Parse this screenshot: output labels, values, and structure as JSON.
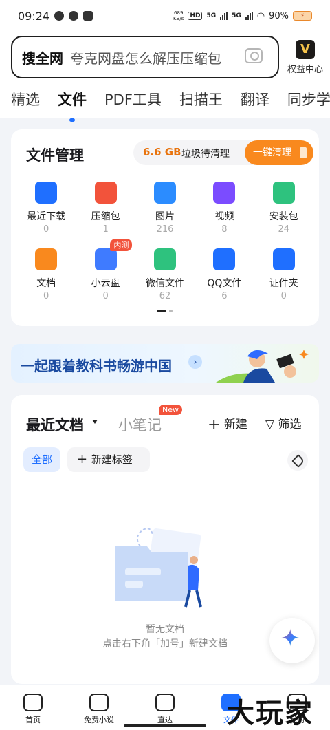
{
  "status": {
    "time": "09:24",
    "net_speed_top": "689",
    "net_speed_bottom": "KB/s",
    "hd": "HD",
    "g5a": "5G",
    "g5b": "5G",
    "battery": "90%"
  },
  "search": {
    "keyword": "搜全网",
    "placeholder": "夸克网盘怎么解压压缩包"
  },
  "vip": {
    "badge": "V",
    "label": "权益中心"
  },
  "tabs": [
    "精选",
    "文件",
    "PDF工具",
    "扫描王",
    "翻译",
    "同步学"
  ],
  "file_manager": {
    "title": "文件管理",
    "junk_size": "6.6 GB",
    "junk_text": "垃圾待清理",
    "clean_button": "一键清理",
    "items": [
      {
        "label": "最近下载",
        "count": "0",
        "icon": "download-icon",
        "color": "#1f6fff"
      },
      {
        "label": "压缩包",
        "count": "1",
        "icon": "zip-icon",
        "color": "#f2533b"
      },
      {
        "label": "图片",
        "count": "216",
        "icon": "image-icon",
        "color": "#2b8cff"
      },
      {
        "label": "视频",
        "count": "8",
        "icon": "video-icon",
        "color": "#7b4cff"
      },
      {
        "label": "安装包",
        "count": "24",
        "icon": "android-icon",
        "color": "#2ec27e"
      },
      {
        "label": "文档",
        "count": "0",
        "icon": "document-icon",
        "color": "#f9891e"
      },
      {
        "label": "小云盘",
        "count": "0",
        "icon": "cloud-icon",
        "color": "#3f7bff",
        "badge": "内测"
      },
      {
        "label": "微信文件",
        "count": "62",
        "icon": "wechat-icon",
        "color": "#2ec27e"
      },
      {
        "label": "QQ文件",
        "count": "6",
        "icon": "qq-icon",
        "color": "#1f6fff"
      },
      {
        "label": "证件夹",
        "count": "0",
        "icon": "wallet-icon",
        "color": "#1f6fff"
      }
    ]
  },
  "banner": {
    "text": "一起跟着教科书畅游中国",
    "arrow": "›"
  },
  "recent": {
    "title": "最近文档",
    "notes": "小笔记",
    "notes_badge": "New",
    "new_label": "新建",
    "filter_label": "筛选",
    "chip_all": "全部",
    "chip_add": "新建标签",
    "empty_title": "暂无文档",
    "empty_hint": "点击右下角「加号」新建文档"
  },
  "nav": [
    {
      "label": "首页",
      "icon": "home-icon"
    },
    {
      "label": "免费小说",
      "icon": "book-icon"
    },
    {
      "label": "直达",
      "icon": "at-icon"
    },
    {
      "label": "文件",
      "icon": "folder-icon",
      "active": true
    },
    {
      "label": "我的",
      "icon": "profile-icon"
    }
  ],
  "watermark": "大玩家"
}
